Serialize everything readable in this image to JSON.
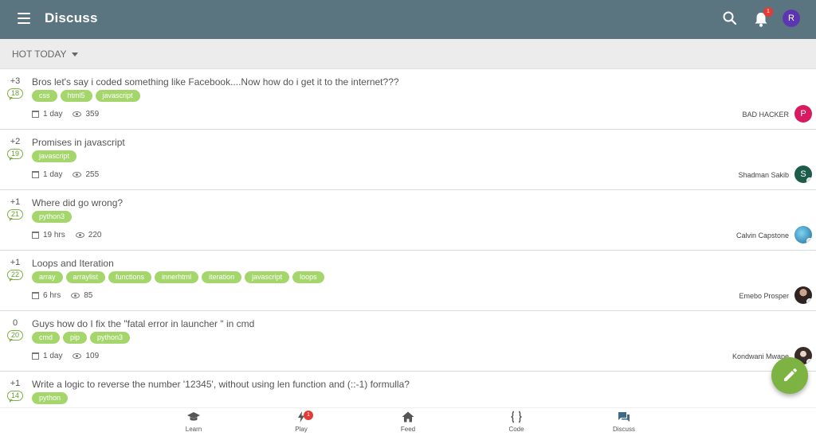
{
  "header": {
    "title": "Discuss",
    "notification_count": "1",
    "user_initial": "R",
    "colors": {
      "bar": "#5a7580",
      "avatar": "#5e35b1",
      "badge": "#e53935"
    }
  },
  "filter": {
    "selected": "HOT TODAY"
  },
  "posts": [
    {
      "votes": "+3",
      "answers": "18",
      "title": "Bros let's say i coded something like Facebook....Now how do i get it to the internet???",
      "tags": [
        "css",
        "html5",
        "javascript"
      ],
      "age": "1 day",
      "views": "359",
      "author": "BAD HACKER",
      "avatar_letter": "P",
      "avatar_color": "#d81b60"
    },
    {
      "votes": "+2",
      "answers": "19",
      "title": "Promises in javascript",
      "tags": [
        "javascript"
      ],
      "age": "1 day",
      "views": "255",
      "author": "Shadman Sakib",
      "avatar_letter": "S",
      "avatar_color": "#1e5c4a"
    },
    {
      "votes": "+1",
      "answers": "21",
      "title": "Where did go wrong?",
      "tags": [
        "python3"
      ],
      "age": "19 hrs",
      "views": "220",
      "author": "Calvin Capstone",
      "avatar_letter": "",
      "avatar_color": "#2b8fb8"
    },
    {
      "votes": "+1",
      "answers": "22",
      "title": "Loops and Iteration",
      "tags": [
        "array",
        "arraylist",
        "functions",
        "innerhtml",
        "iteration",
        "javascript",
        "loops"
      ],
      "age": "6 hrs",
      "views": "85",
      "author": "Emebo Prosper",
      "avatar_letter": "",
      "avatar_color": "#4a3a34"
    },
    {
      "votes": "0",
      "answers": "20",
      "title": "Guys how do I fix the \"fatal error in launcher \" in cmd",
      "tags": [
        "cmd",
        "pip",
        "python3"
      ],
      "age": "1 day",
      "views": "109",
      "author": "Kondwani Mwape",
      "avatar_letter": "",
      "avatar_color": "#5b4a44"
    },
    {
      "votes": "+1",
      "answers": "14",
      "title": "Write a logic to reverse the number '12345', without using len function and (::-1) formulla?",
      "tags": [
        "python"
      ],
      "age": "",
      "views": "",
      "author": "",
      "avatar_letter": "",
      "avatar_color": ""
    }
  ],
  "fab": {
    "icon": "pencil-icon",
    "color": "#7cb342"
  },
  "bottom_nav": {
    "learn": "Learn",
    "play": "Play",
    "play_badge": "1",
    "feed": "Feed",
    "code": "Code",
    "discuss": "Discuss"
  },
  "tag_color": "#a5d66b"
}
